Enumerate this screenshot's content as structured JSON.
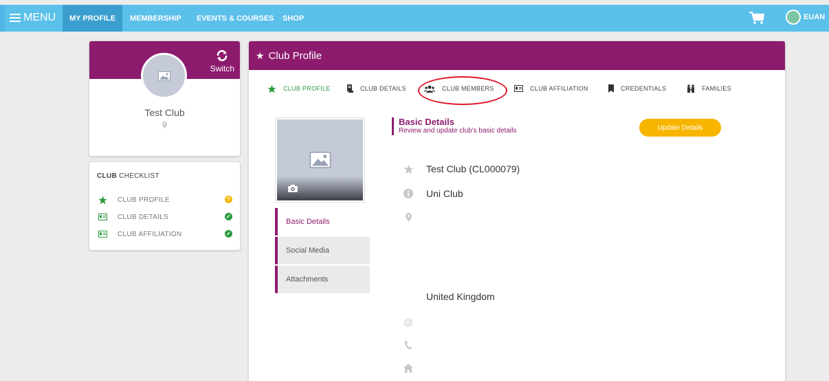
{
  "nav": {
    "menu_label": "MENU",
    "items": [
      "MY PROFILE",
      "MEMBERSHIP",
      "EVENTS & COURSES",
      "SHOP"
    ],
    "user_name": "EUAN"
  },
  "profile_card": {
    "switch_label": "Switch",
    "club_name": "Test Club"
  },
  "checklist": {
    "title_bold": "CLUB",
    "title_rest": " CHECKLIST",
    "items": [
      {
        "label": "CLUB PROFILE",
        "status": "incomplete"
      },
      {
        "label": "CLUB DETAILS",
        "status": "complete"
      },
      {
        "label": "CLUB AFFILIATION",
        "status": "complete"
      }
    ]
  },
  "main": {
    "title": "Club Profile",
    "tabs": [
      "CLUB PROFILE",
      "CLUB DETAILS",
      "CLUB MEMBERS",
      "CLUB AFFILIATION",
      "CREDENTIALS",
      "FAMILIES"
    ],
    "active_tab": "CLUB PROFILE",
    "highlighted_tab": "CLUB MEMBERS",
    "sub_nav": [
      "Basic Details",
      "Social Media",
      "Attachments"
    ],
    "section_title": "Basic Details",
    "section_subtitle": "Review and update club's basic details",
    "update_button": "Update Details",
    "details": {
      "name": "Test Club (CL000079)",
      "type": "Uni Club",
      "country": "United Kingdom"
    }
  },
  "colors": {
    "brand": "#8c1b6e",
    "nav": "#5bc0ea",
    "accent": "#f7b500",
    "success": "#2b9a3f",
    "highlight": "#e1162b"
  }
}
